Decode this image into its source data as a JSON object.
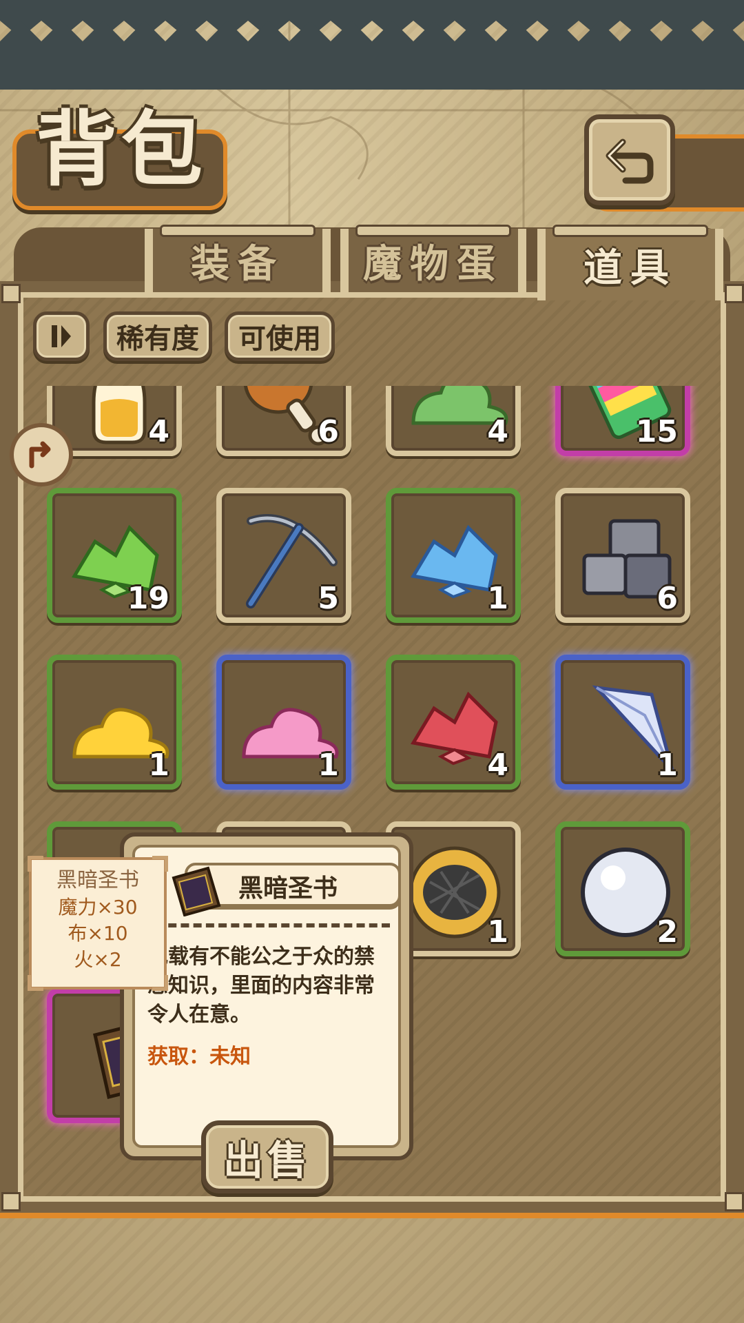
{
  "header": {
    "title": "背包"
  },
  "tabs": [
    {
      "label": "装备",
      "active": false
    },
    {
      "label": "魔物蛋",
      "active": false
    },
    {
      "label": "道具",
      "active": true
    }
  ],
  "filters": {
    "toggle_icon": "pause-sort-icon",
    "rarity_label": "稀有度",
    "usable_label": "可使用"
  },
  "items": [
    {
      "icon": "potion-bottle-icon",
      "qty": "4",
      "rarity": "common"
    },
    {
      "icon": "meat-drumstick-icon",
      "qty": "6",
      "rarity": "common"
    },
    {
      "icon": "green-slime-icon",
      "qty": "4",
      "rarity": "common"
    },
    {
      "icon": "rainbow-popsicle-icon",
      "qty": "15",
      "rarity": "epic"
    },
    {
      "icon": "green-crystal-icon",
      "qty": "19",
      "rarity": "uncommon"
    },
    {
      "icon": "pickaxe-icon",
      "qty": "5",
      "rarity": "common"
    },
    {
      "icon": "blue-crystal-icon",
      "qty": "1",
      "rarity": "uncommon"
    },
    {
      "icon": "stone-blocks-icon",
      "qty": "6",
      "rarity": "common"
    },
    {
      "icon": "yellow-slime-icon",
      "qty": "1",
      "rarity": "uncommon"
    },
    {
      "icon": "pink-slime-icon",
      "qty": "1",
      "rarity": "rare"
    },
    {
      "icon": "red-crystal-icon",
      "qty": "4",
      "rarity": "uncommon"
    },
    {
      "icon": "diamond-shard-icon",
      "qty": "1",
      "rarity": "rare"
    },
    {
      "icon": "cookie-icon",
      "qty": "1",
      "rarity": "common"
    },
    {
      "icon": "pearl-orb-icon",
      "qty": "2",
      "rarity": "uncommon"
    },
    {
      "icon": "dark-book-icon",
      "qty": "",
      "rarity": "epic"
    }
  ],
  "detail": {
    "name": "黑暗圣书",
    "description": "记载有不能公之于众的禁忌知识，里面的内容非常令人在意。",
    "obtain": "获取：未知",
    "sell_label": "出售"
  },
  "recipe": {
    "name": "黑暗圣书",
    "lines": [
      "魔力×30",
      "布×10",
      "火×2"
    ]
  },
  "colors": {
    "accent": "#e08a2a",
    "frame": "#d9c79e",
    "uncommon": "#5f9a3a",
    "rare": "#4a62c8",
    "epic": "#c23ea8",
    "obtain": "#c8560e"
  }
}
